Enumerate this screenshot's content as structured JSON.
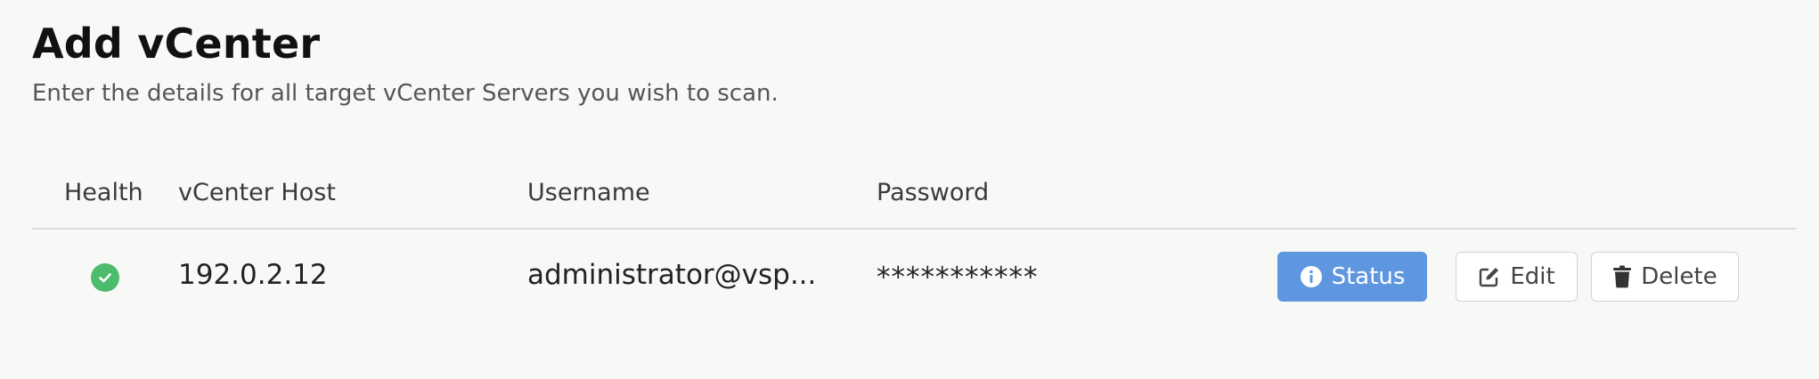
{
  "header": {
    "title": "Add vCenter",
    "subtitle": "Enter the details for all target vCenter Servers you wish to scan."
  },
  "table": {
    "columns": [
      "Health",
      "vCenter Host",
      "Username",
      "Password"
    ],
    "rows": [
      {
        "health": "healthy",
        "host": "192.0.2.12",
        "username": "administrator@vsp...",
        "password": "***********",
        "actions": {
          "status": "Status",
          "edit": "Edit",
          "delete": "Delete"
        }
      }
    ]
  },
  "colors": {
    "status_button": "#5e97e0",
    "health_ok": "#4cbb6c",
    "background": "#f7f9f7"
  },
  "icons": {
    "health": "check-circle-icon",
    "status": "info-circle-icon",
    "edit": "edit-icon",
    "delete": "trash-icon"
  }
}
